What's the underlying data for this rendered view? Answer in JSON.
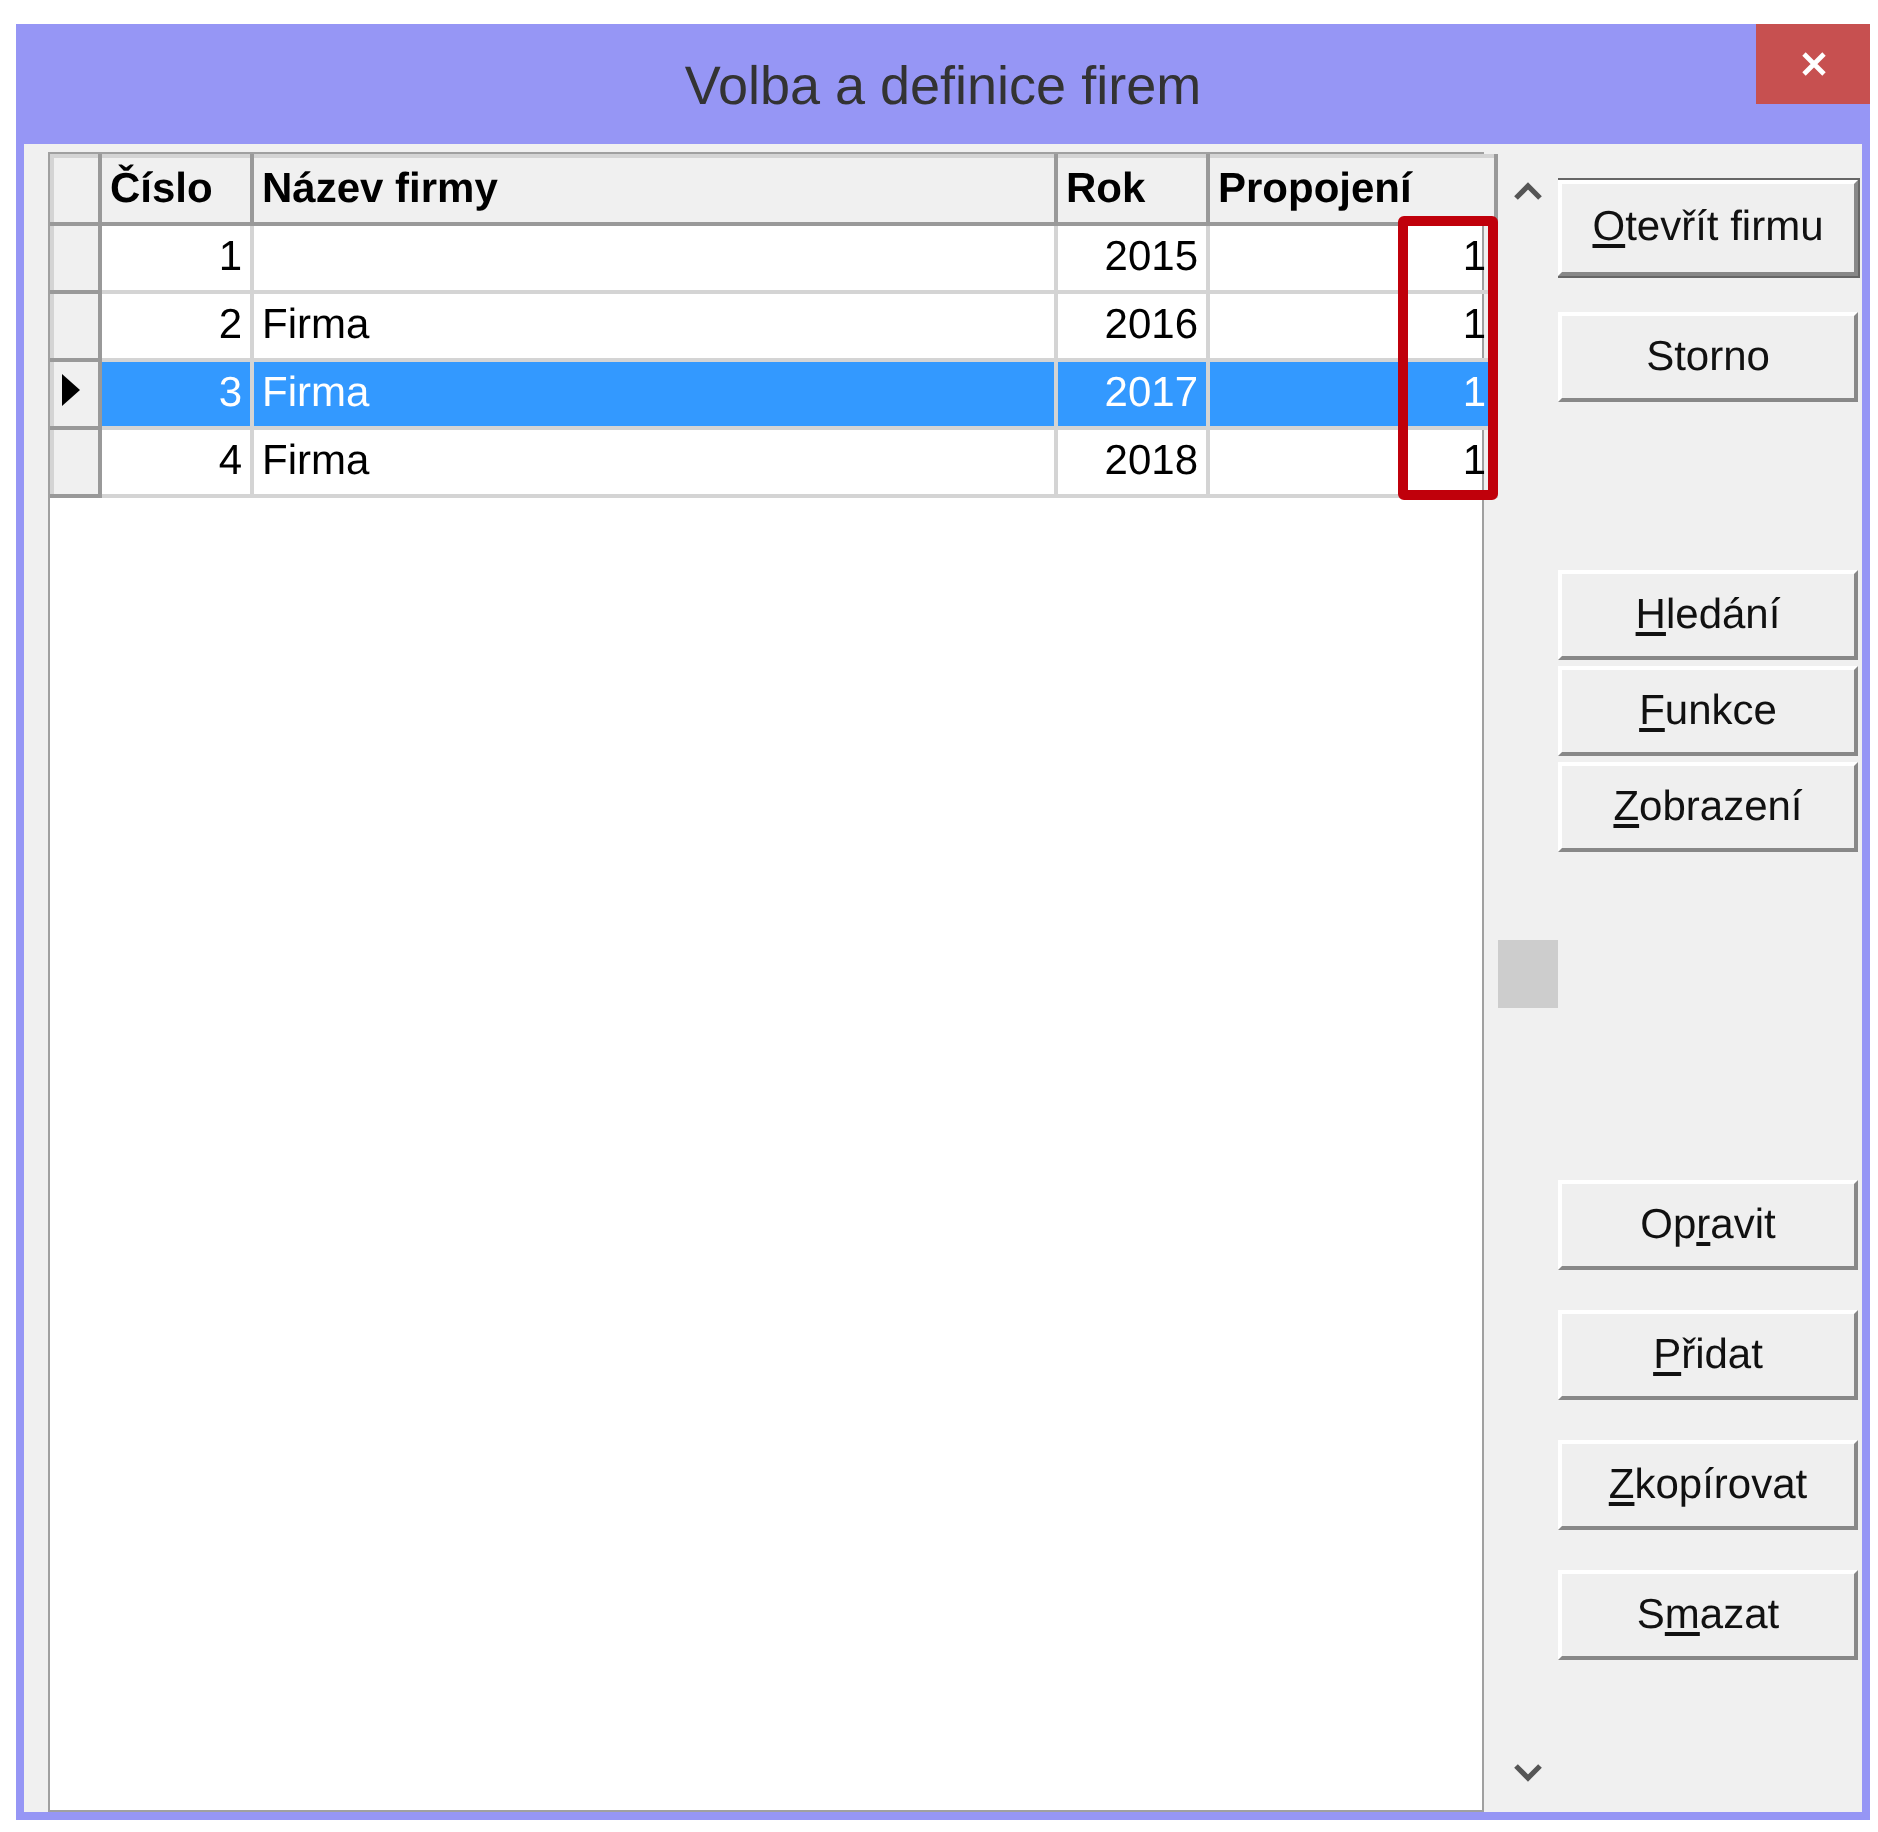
{
  "window": {
    "title": "Volba a definice firem"
  },
  "table": {
    "columns": [
      {
        "label": "Číslo",
        "kind": "number",
        "highlighted": false
      },
      {
        "label": "Název firmy",
        "kind": "text",
        "highlighted": false
      },
      {
        "label": "Rok",
        "kind": "number",
        "highlighted": false
      },
      {
        "label": "Propojení",
        "kind": "number",
        "highlighted": true
      }
    ],
    "rows": [
      {
        "selected": false,
        "cells": [
          "1",
          "",
          "2015",
          "1"
        ]
      },
      {
        "selected": false,
        "cells": [
          "2",
          "Firma",
          "2016",
          "1"
        ]
      },
      {
        "selected": true,
        "cells": [
          "3",
          "Firma",
          "2017",
          "1"
        ]
      },
      {
        "selected": false,
        "cells": [
          "4",
          "Firma",
          "2018",
          "1"
        ]
      }
    ]
  },
  "button_groups": [
    [
      {
        "key": "O",
        "after": "tevřít firmu"
      },
      {
        "before": "Storno"
      }
    ],
    [
      {
        "key": "H",
        "after": "ledání"
      },
      {
        "key": "F",
        "after": "unkce"
      },
      {
        "key": "Z",
        "after": "obrazení"
      }
    ],
    [
      {
        "before": "Op",
        "key": "r",
        "after": "avit"
      },
      {
        "key": "P",
        "after": "řidat"
      },
      {
        "key": "Z",
        "after": "kopírovat"
      },
      {
        "before": "S",
        "key": "m",
        "after": "azat"
      }
    ]
  ]
}
